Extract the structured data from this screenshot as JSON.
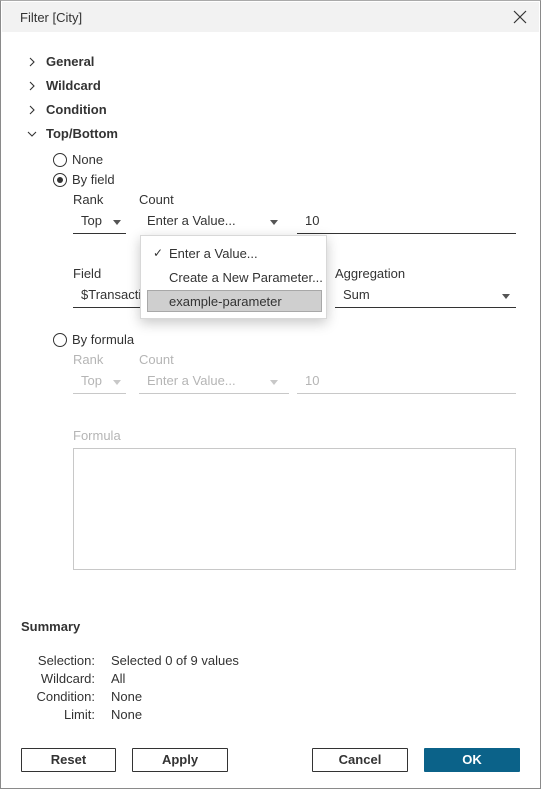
{
  "window": {
    "title": "Filter [City]"
  },
  "sections": [
    {
      "label": "General",
      "expanded": false
    },
    {
      "label": "Wildcard",
      "expanded": false
    },
    {
      "label": "Condition",
      "expanded": false
    },
    {
      "label": "Top/Bottom",
      "expanded": true
    }
  ],
  "topbottom": {
    "options": [
      {
        "label": "None",
        "selected": false
      },
      {
        "label": "By field",
        "selected": true
      },
      {
        "label": "By formula",
        "selected": false
      }
    ],
    "by_field": {
      "rank_label": "Rank",
      "count_label": "Count",
      "rank_value": "Top",
      "count_value": "Enter a Value...",
      "count_number": "10",
      "field_label": "Field",
      "field_value": "$Transacti",
      "aggregation_label": "Aggregation",
      "aggregation_value": "Sum"
    },
    "by_formula": {
      "rank_label": "Rank",
      "count_label": "Count",
      "rank_value": "Top",
      "count_value": "Enter a Value...",
      "count_number": "10",
      "formula_label": "Formula",
      "formula_value": ""
    }
  },
  "count_dropdown": {
    "items": [
      {
        "label": "Enter a Value...",
        "checked": true,
        "check_glyph": "✓",
        "highlighted": false
      },
      {
        "label": "Create a New Parameter...",
        "checked": false,
        "check_glyph": "",
        "highlighted": false
      },
      {
        "label": "example-parameter",
        "checked": false,
        "check_glyph": "",
        "highlighted": true
      }
    ]
  },
  "summary": {
    "title": "Summary",
    "rows": [
      {
        "key": "Selection:",
        "value": "Selected 0 of 9 values"
      },
      {
        "key": "Wildcard:",
        "value": "All"
      },
      {
        "key": "Condition:",
        "value": "None"
      },
      {
        "key": "Limit:",
        "value": "None"
      }
    ]
  },
  "buttons": {
    "reset": "Reset",
    "apply": "Apply",
    "cancel": "Cancel",
    "ok": "OK"
  },
  "colors": {
    "primary_button": "#0b6289",
    "titlebar": "#f2f2f2",
    "highlight": "#cfcfcf"
  }
}
